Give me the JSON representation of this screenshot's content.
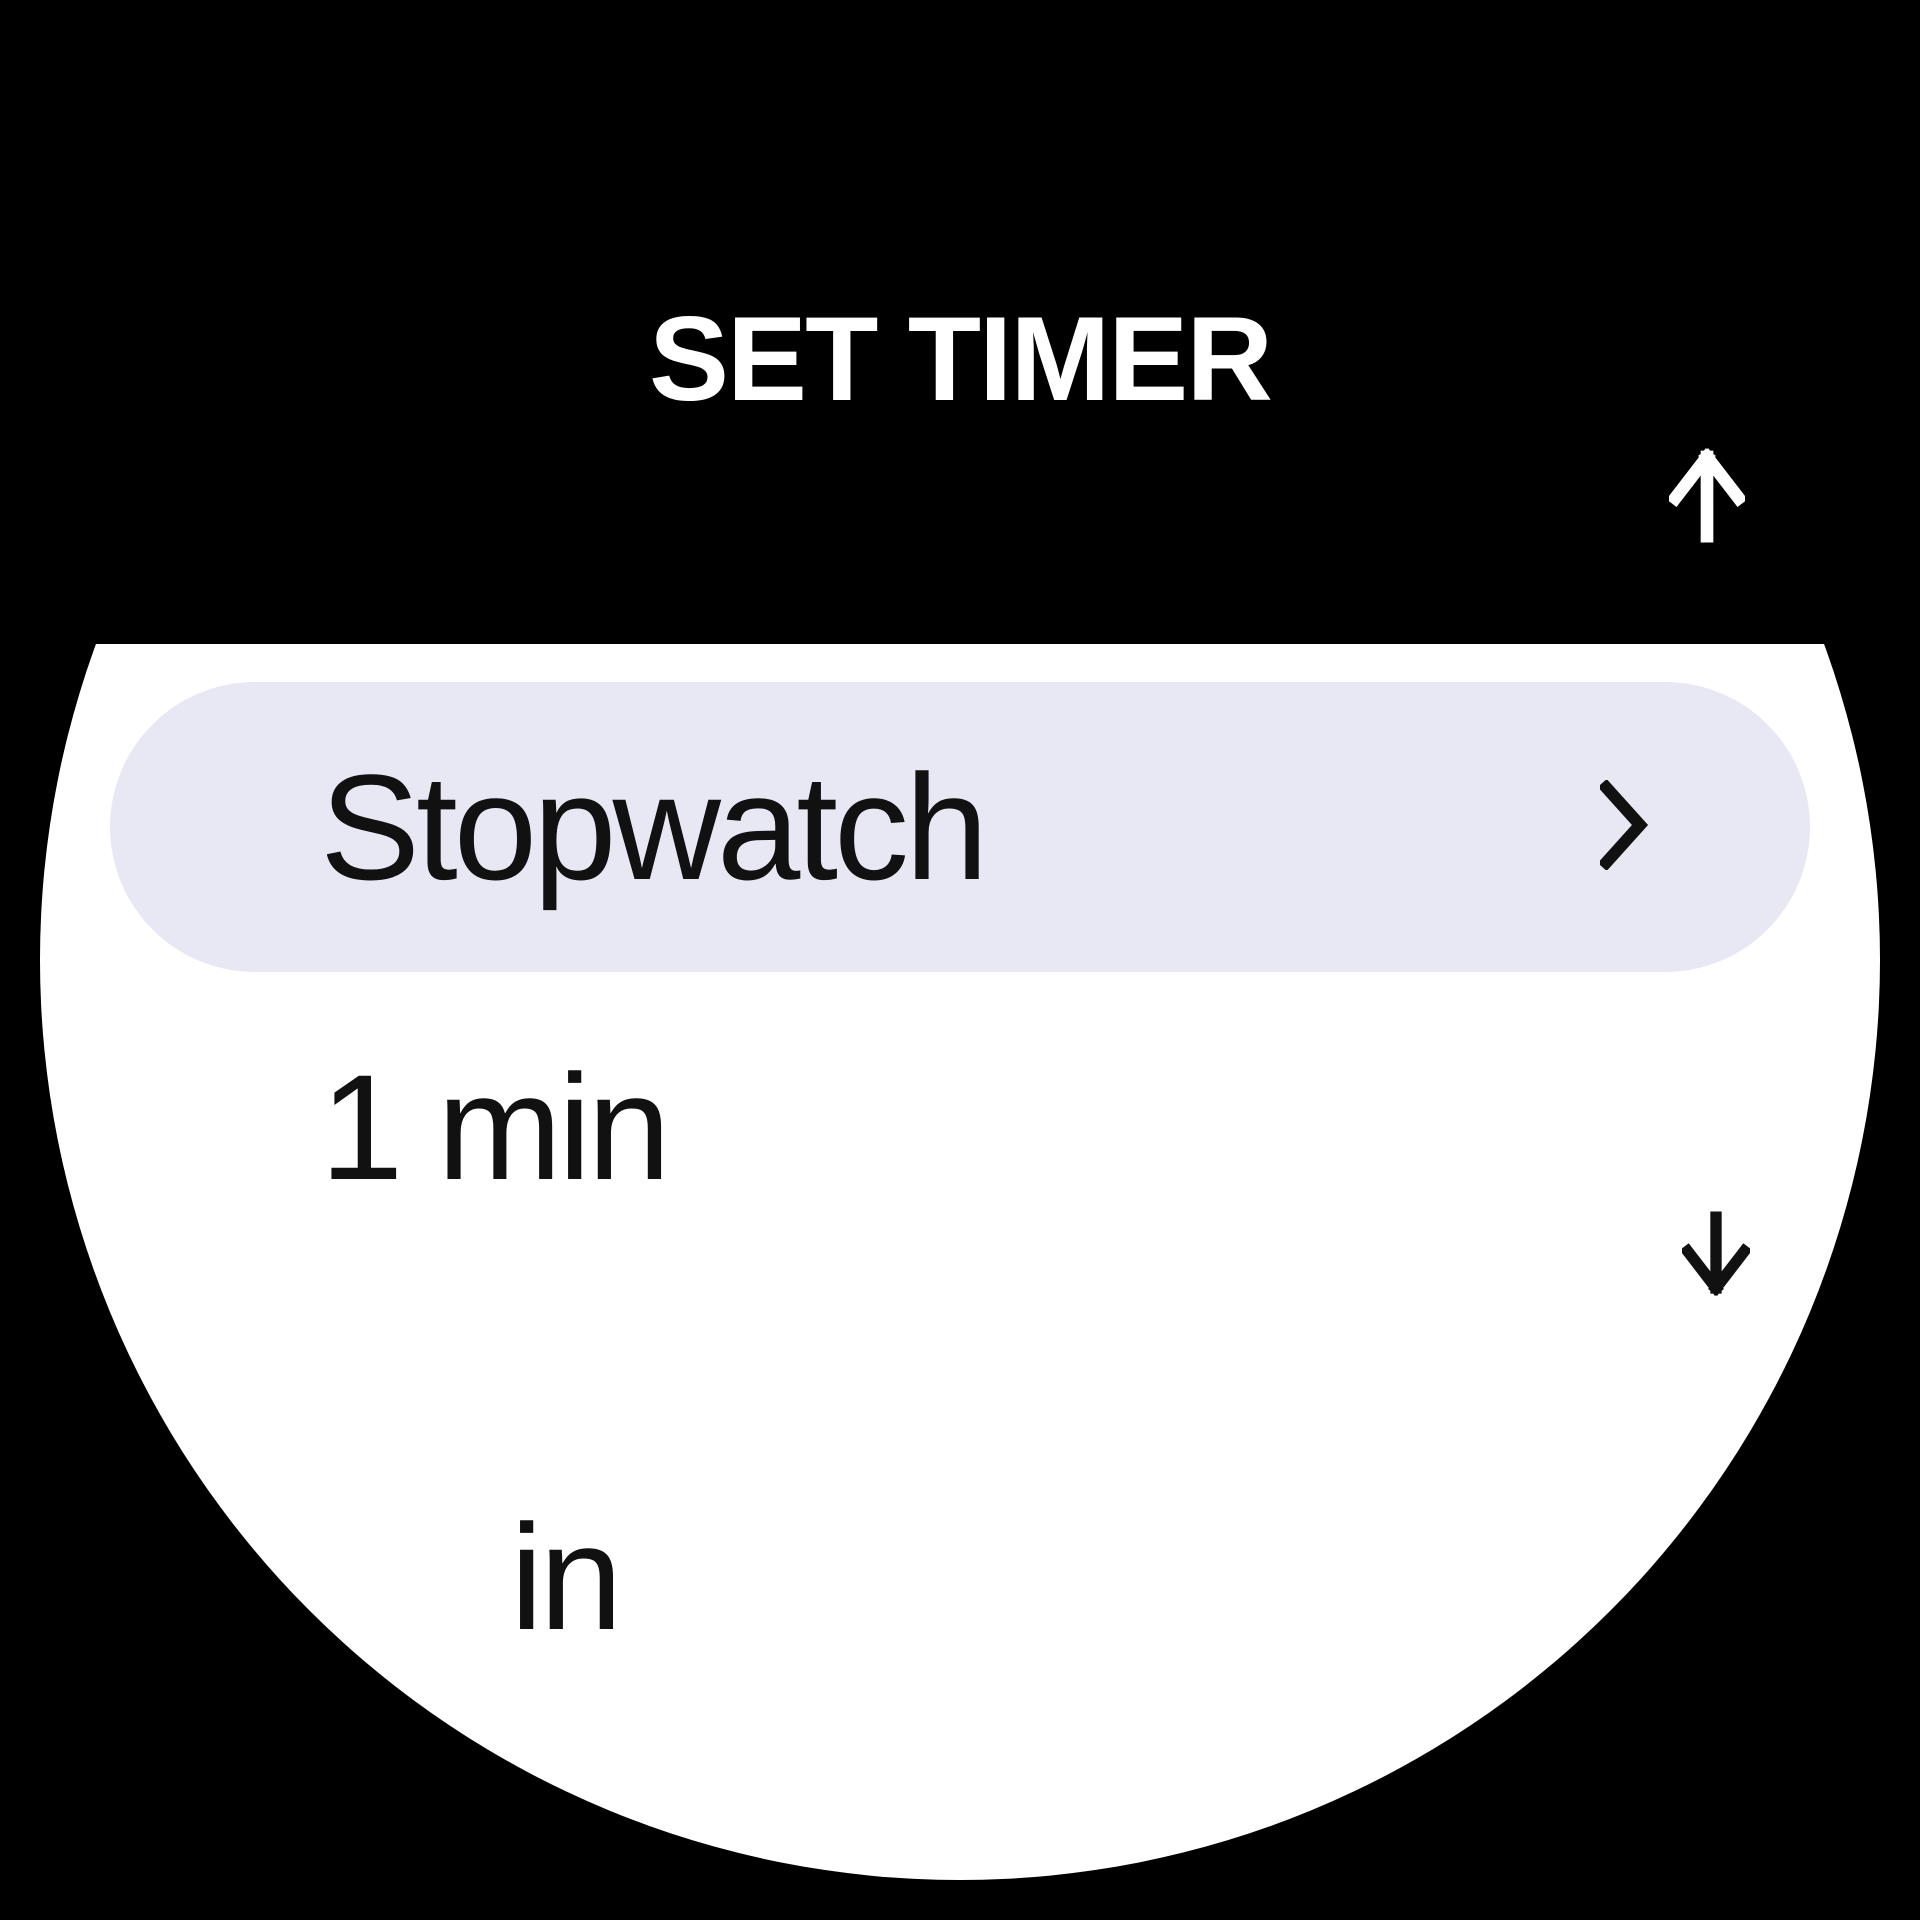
{
  "title": "SET TIMER",
  "items": [
    {
      "label": "Stopwatch",
      "selected": true,
      "has_chevron": true
    },
    {
      "label": "1 min",
      "selected": false,
      "has_chevron": false
    },
    {
      "label": "in",
      "selected": false,
      "has_chevron": false
    }
  ]
}
